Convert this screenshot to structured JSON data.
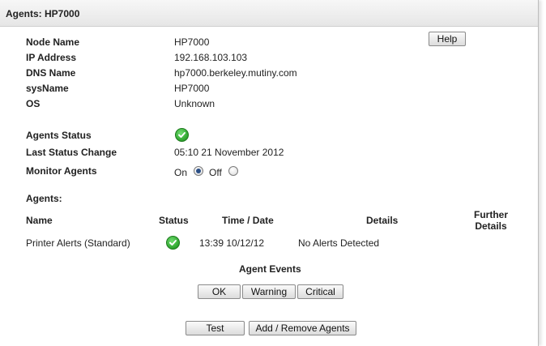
{
  "panel": {
    "title": "Agents: HP7000"
  },
  "help_label": "Help",
  "node": {
    "name_label": "Node Name",
    "name": "HP7000",
    "ip_label": "IP Address",
    "ip": "192.168.103.103",
    "dns_label": "DNS Name",
    "dns": "hp7000.berkeley.mutiny.com",
    "sysname_label": "sysName",
    "sysname": "HP7000",
    "os_label": "OS",
    "os": "Unknown"
  },
  "status": {
    "agents_status_label": "Agents Status",
    "agents_status_icon": "check-circle-icon",
    "last_change_label": "Last Status Change",
    "last_change": "05:10 21 November 2012",
    "monitor_label": "Monitor Agents",
    "on_label": "On",
    "off_label": "Off",
    "monitor_selected": "On"
  },
  "agents": {
    "section_label": "Agents:",
    "columns": {
      "name": "Name",
      "status": "Status",
      "time": "Time / Date",
      "details": "Details",
      "further1": "Further",
      "further2": "Details"
    },
    "rows": [
      {
        "name": "Printer Alerts (Standard)",
        "status_icon": "check-circle-icon",
        "time": "13:39 10/12/12",
        "details": "No Alerts Detected"
      }
    ]
  },
  "events": {
    "label": "Agent Events",
    "ok": "OK",
    "warning": "Warning",
    "critical": "Critical"
  },
  "actions": {
    "test": "Test",
    "add_remove": "Add / Remove Agents"
  },
  "colors": {
    "status_ok": "#2ea42e",
    "radio_fill": "#2b4f86"
  }
}
